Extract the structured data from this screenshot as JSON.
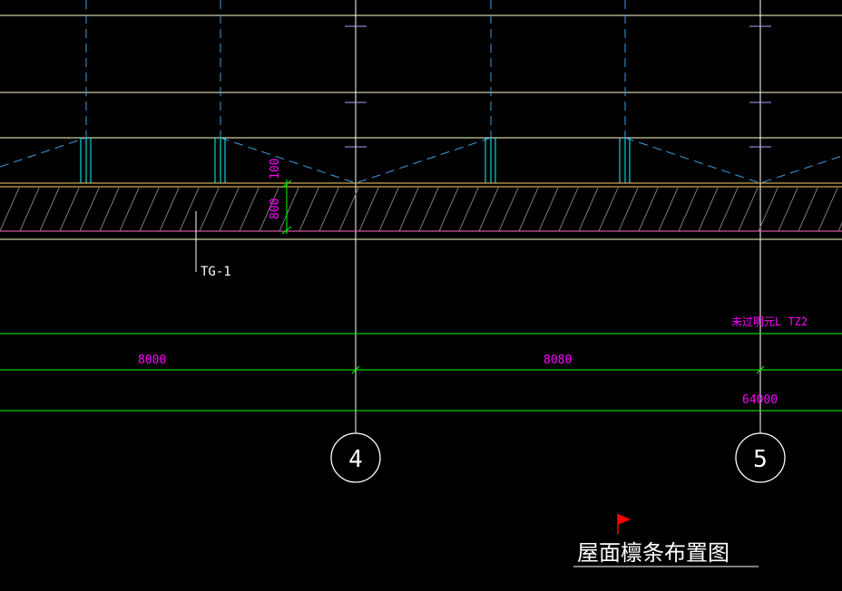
{
  "drawing": {
    "title": "屋面檩条布置图",
    "member_label": "TG-1",
    "dim_small_top": "100",
    "dim_small_side": "800",
    "annotation_magenta": "未过明元L TZ2",
    "span_left": "8000",
    "span_right": "8080",
    "overall_dim": "64000",
    "axis_left": "4",
    "axis_right": "5"
  },
  "colors": {
    "background": "#000000",
    "light_yellow": "#ffffc8",
    "cyan": "#00ffff",
    "cyan_dash": "#3aa0e0",
    "magenta": "#ff00ff",
    "green": "#00ff00",
    "orange": "#ffcc66",
    "pink": "#ff66cc",
    "white": "#ffffff",
    "hatch_gray": "#7a7a7a",
    "flag_red": "#ff0000",
    "purple_tick": "#b0a0ff"
  },
  "icons": {
    "flag": "red-flag-icon"
  }
}
